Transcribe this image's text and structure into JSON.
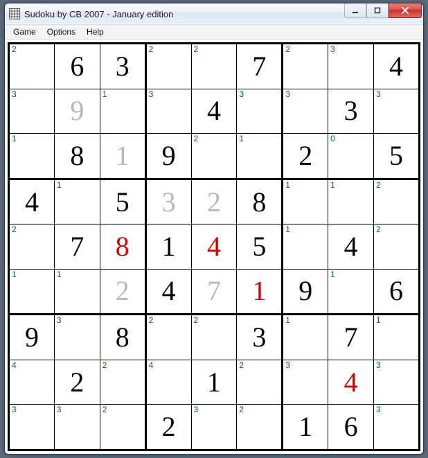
{
  "window": {
    "title": "Sudoku by CB 2007 - January edition"
  },
  "menu": {
    "items": [
      "Game",
      "Options",
      "Help"
    ]
  },
  "icons": {
    "app": "grid-icon",
    "minimize": "minimize-icon",
    "maximize": "maximize-icon",
    "close": "close-icon"
  },
  "colors": {
    "hint": "#0a6a1a",
    "value_default": "#000000",
    "value_error": "#d40000",
    "value_fixed": "#b8b8b8",
    "close_btn": "#d9534f"
  },
  "board": {
    "size": 9,
    "cells": [
      [
        {
          "hint": "2",
          "value": "",
          "color": "black"
        },
        {
          "hint": "",
          "value": "6",
          "color": "black"
        },
        {
          "hint": "",
          "value": "3",
          "color": "black"
        },
        {
          "hint": "2",
          "value": "",
          "color": "black"
        },
        {
          "hint": "2",
          "value": "",
          "color": "black"
        },
        {
          "hint": "",
          "value": "7",
          "color": "black"
        },
        {
          "hint": "2",
          "value": "",
          "color": "black"
        },
        {
          "hint": "3",
          "value": "",
          "color": "black"
        },
        {
          "hint": "",
          "value": "4",
          "color": "black"
        }
      ],
      [
        {
          "hint": "3",
          "value": "",
          "color": "black"
        },
        {
          "hint": "",
          "value": "9",
          "color": "gray"
        },
        {
          "hint": "1",
          "value": "",
          "color": "black"
        },
        {
          "hint": "3",
          "value": "",
          "color": "black"
        },
        {
          "hint": "",
          "value": "4",
          "color": "black"
        },
        {
          "hint": "3",
          "value": "",
          "color": "black"
        },
        {
          "hint": "3",
          "value": "",
          "color": "black"
        },
        {
          "hint": "",
          "value": "3",
          "color": "black"
        },
        {
          "hint": "3",
          "value": "",
          "color": "black"
        }
      ],
      [
        {
          "hint": "1",
          "value": "",
          "color": "black"
        },
        {
          "hint": "",
          "value": "8",
          "color": "black"
        },
        {
          "hint": "",
          "value": "1",
          "color": "gray"
        },
        {
          "hint": "",
          "value": "9",
          "color": "black"
        },
        {
          "hint": "2",
          "value": "",
          "color": "black"
        },
        {
          "hint": "1",
          "value": "",
          "color": "black"
        },
        {
          "hint": "",
          "value": "2",
          "color": "black"
        },
        {
          "hint": "0",
          "value": "",
          "color": "black"
        },
        {
          "hint": "",
          "value": "5",
          "color": "black"
        }
      ],
      [
        {
          "hint": "",
          "value": "4",
          "color": "black"
        },
        {
          "hint": "1",
          "value": "",
          "color": "black"
        },
        {
          "hint": "",
          "value": "5",
          "color": "black"
        },
        {
          "hint": "",
          "value": "3",
          "color": "gray"
        },
        {
          "hint": "",
          "value": "2",
          "color": "gray"
        },
        {
          "hint": "",
          "value": "8",
          "color": "black"
        },
        {
          "hint": "1",
          "value": "",
          "color": "black"
        },
        {
          "hint": "1",
          "value": "",
          "color": "black"
        },
        {
          "hint": "2",
          "value": "",
          "color": "black"
        }
      ],
      [
        {
          "hint": "2",
          "value": "",
          "color": "black"
        },
        {
          "hint": "",
          "value": "7",
          "color": "black"
        },
        {
          "hint": "",
          "value": "8",
          "color": "red"
        },
        {
          "hint": "",
          "value": "1",
          "color": "black"
        },
        {
          "hint": "",
          "value": "4",
          "color": "red"
        },
        {
          "hint": "",
          "value": "5",
          "color": "black"
        },
        {
          "hint": "1",
          "value": "",
          "color": "black"
        },
        {
          "hint": "",
          "value": "4",
          "color": "black"
        },
        {
          "hint": "2",
          "value": "",
          "color": "black"
        }
      ],
      [
        {
          "hint": "1",
          "value": "",
          "color": "black"
        },
        {
          "hint": "1",
          "value": "",
          "color": "black"
        },
        {
          "hint": "",
          "value": "2",
          "color": "gray"
        },
        {
          "hint": "",
          "value": "4",
          "color": "black"
        },
        {
          "hint": "",
          "value": "7",
          "color": "gray"
        },
        {
          "hint": "",
          "value": "1",
          "color": "red"
        },
        {
          "hint": "",
          "value": "9",
          "color": "black"
        },
        {
          "hint": "1",
          "value": "",
          "color": "black"
        },
        {
          "hint": "",
          "value": "6",
          "color": "black"
        }
      ],
      [
        {
          "hint": "",
          "value": "9",
          "color": "black"
        },
        {
          "hint": "3",
          "value": "",
          "color": "black"
        },
        {
          "hint": "",
          "value": "8",
          "color": "black"
        },
        {
          "hint": "2",
          "value": "",
          "color": "black"
        },
        {
          "hint": "2",
          "value": "",
          "color": "black"
        },
        {
          "hint": "",
          "value": "3",
          "color": "black"
        },
        {
          "hint": "1",
          "value": "",
          "color": "black"
        },
        {
          "hint": "",
          "value": "7",
          "color": "black"
        },
        {
          "hint": "1",
          "value": "",
          "color": "black"
        }
      ],
      [
        {
          "hint": "4",
          "value": "",
          "color": "black"
        },
        {
          "hint": "",
          "value": "2",
          "color": "black"
        },
        {
          "hint": "2",
          "value": "",
          "color": "black"
        },
        {
          "hint": "4",
          "value": "",
          "color": "black"
        },
        {
          "hint": "",
          "value": "1",
          "color": "black"
        },
        {
          "hint": "2",
          "value": "",
          "color": "black"
        },
        {
          "hint": "3",
          "value": "",
          "color": "black"
        },
        {
          "hint": "",
          "value": "4",
          "color": "red"
        },
        {
          "hint": "3",
          "value": "",
          "color": "black"
        }
      ],
      [
        {
          "hint": "3",
          "value": "",
          "color": "black"
        },
        {
          "hint": "3",
          "value": "",
          "color": "black"
        },
        {
          "hint": "2",
          "value": "",
          "color": "black"
        },
        {
          "hint": "",
          "value": "2",
          "color": "black"
        },
        {
          "hint": "3",
          "value": "",
          "color": "black"
        },
        {
          "hint": "2",
          "value": "",
          "color": "black"
        },
        {
          "hint": "",
          "value": "1",
          "color": "black"
        },
        {
          "hint": "",
          "value": "6",
          "color": "black"
        },
        {
          "hint": "3",
          "value": "",
          "color": "black"
        }
      ]
    ]
  }
}
